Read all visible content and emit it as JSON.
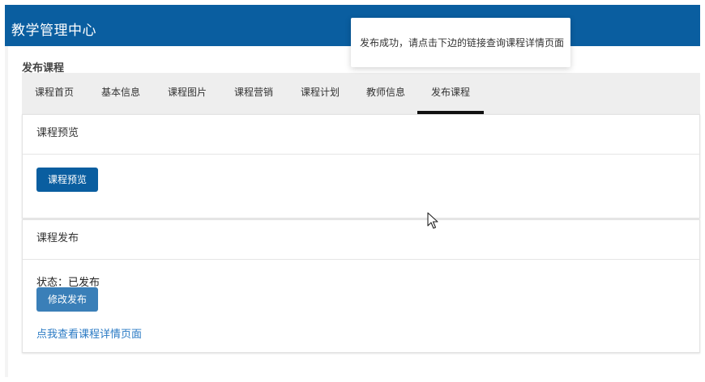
{
  "header": {
    "app_title": "教学管理中心"
  },
  "page": {
    "section_title": "发布课程"
  },
  "tabs": [
    {
      "label": "课程首页",
      "active": false
    },
    {
      "label": "基本信息",
      "active": false
    },
    {
      "label": "课程图片",
      "active": false
    },
    {
      "label": "课程营销",
      "active": false
    },
    {
      "label": "课程计划",
      "active": false
    },
    {
      "label": "教师信息",
      "active": false
    },
    {
      "label": "发布课程",
      "active": true
    }
  ],
  "preview_card": {
    "title": "课程预览",
    "button_label": "课程预览"
  },
  "publish_card": {
    "title": "课程发布",
    "status_text": "状态：已发布",
    "button_label": "修改发布",
    "link_text": "点我查看课程详情页面"
  },
  "toast": {
    "message": "发布成功，请点击下边的链接查询课程详情页面"
  },
  "colors": {
    "brand": "#0a5ea0",
    "button_secondary": "#3a7fb8",
    "link": "#2a7ac4",
    "tab_bar": "#eeeeee"
  }
}
